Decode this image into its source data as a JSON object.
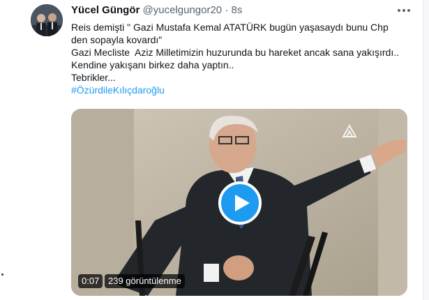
{
  "tweet": {
    "author_name": "Yücel Güngör",
    "handle": "@yucelgungor20",
    "separator": "·",
    "age": "8s",
    "lines": [
      "Reis demişti \" Gazi Mustafa Kemal ATATÜRK bugün yaşasaydı bunu Chp",
      "den sopayla kovardı\"",
      "Gazi Mecliste  Aziz Milletimizin huzurunda bu hareket ancak sana yakışırdı..",
      "Kendine yakışanı birkez daha yaptın..",
      "Tebrikler..."
    ],
    "hashtag": "#ÖzürdileKılıçdaroğlu"
  },
  "video": {
    "time": "0:07",
    "views": "239 görüntülenme"
  },
  "icons": {
    "more": "more-horizontal-icon",
    "play": "play-icon",
    "watermark": "aa-logo-icon"
  },
  "colors": {
    "accent": "#1d9bf0",
    "text": "#0f1419",
    "secondary": "#536471"
  }
}
